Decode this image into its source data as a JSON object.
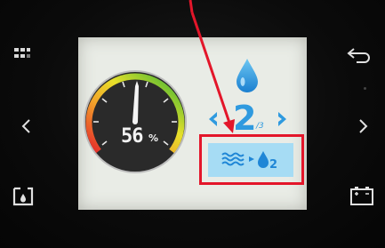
{
  "device": {
    "left_buttons": [
      {
        "icon": "menu-grid-icon"
      },
      {
        "icon": "chevron-left-icon"
      },
      {
        "icon": "water-tank-icon"
      }
    ],
    "right_buttons": [
      {
        "icon": "back-arrow-icon"
      },
      {
        "icon": "chevron-right-icon"
      },
      {
        "icon": "battery-icon"
      }
    ]
  },
  "screen": {
    "gauge": {
      "value": "56",
      "unit": "%",
      "fraction": 0.56
    },
    "level": {
      "current": "2",
      "max": "/3"
    },
    "mode_icon": "water-to-droplet-icon",
    "mode_subscript": "2"
  },
  "annotation": {
    "color": "#e3162a"
  }
}
